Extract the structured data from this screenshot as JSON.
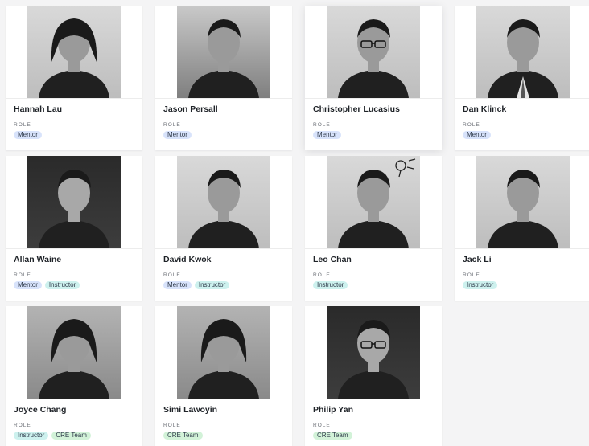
{
  "role_label": "ROLE",
  "badge_colors": {
    "Mentor": "#d8e3fb",
    "Instructor": "#cdf1ee",
    "CRE Team": "#d2f2d8"
  },
  "people": [
    {
      "name": "Hannah Lau",
      "roles": [
        "Mentor"
      ],
      "photo": "woman-portrait-icon",
      "tone": "light"
    },
    {
      "name": "Jason Persall",
      "roles": [
        "Mentor"
      ],
      "photo": "man-portrait-icon",
      "tone": "field"
    },
    {
      "name": "Christopher Lucasius",
      "roles": [
        "Mentor"
      ],
      "photo": "man-glasses-portrait-icon",
      "tone": "light"
    },
    {
      "name": "Dan Klinck",
      "roles": [
        "Mentor"
      ],
      "photo": "man-suit-portrait-icon",
      "tone": "light"
    },
    {
      "name": "Allan Waine",
      "roles": [
        "Mentor",
        "Instructor"
      ],
      "photo": "man-portrait-icon",
      "tone": "dark"
    },
    {
      "name": "David Kwok",
      "roles": [
        "Mentor",
        "Instructor"
      ],
      "photo": "man-portrait-icon",
      "tone": "light"
    },
    {
      "name": "Leo Chan",
      "roles": [
        "Instructor"
      ],
      "photo": "man-lightbulb-portrait-icon",
      "tone": "light"
    },
    {
      "name": "Jack Li",
      "roles": [
        "Instructor"
      ],
      "photo": "man-portrait-icon",
      "tone": "light"
    },
    {
      "name": "Joyce Chang",
      "roles": [
        "Instructor",
        "CRE Team"
      ],
      "photo": "woman-portrait-icon",
      "tone": "outdoor"
    },
    {
      "name": "Simi Lawoyin",
      "roles": [
        "CRE Team"
      ],
      "photo": "woman-portrait-icon",
      "tone": "outdoor"
    },
    {
      "name": "Philip Yan",
      "roles": [
        "CRE Team"
      ],
      "photo": "man-glasses-portrait-icon",
      "tone": "dark"
    }
  ]
}
